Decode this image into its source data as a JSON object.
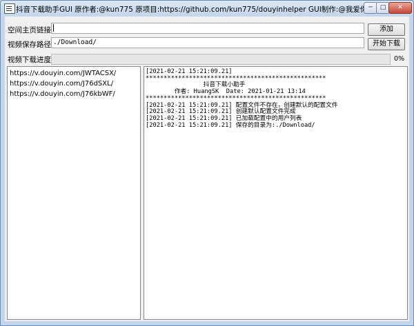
{
  "window": {
    "title": "抖音下载助手GUI 原作者:@kun775 原项目:https://github.com/kun775/douyinhelper GUI制作:@我爱你H大",
    "controls": {
      "minimize": "─",
      "maximize": "□",
      "close": "✕"
    }
  },
  "form": {
    "homepage_label": "空间主页链接",
    "homepage_value": "",
    "add_button": "添加",
    "save_path_label": "视频保存路径",
    "save_path_value": "./Download/",
    "start_button": "开始下载",
    "progress_label": "视频下载进度",
    "progress_value": 0,
    "progress_text": "0%"
  },
  "url_list": [
    "https://v.douyin.com/JWTACSX/",
    "https://v.douyin.com/J76dSXL/",
    "https://v.douyin.com/J76kbWF/"
  ],
  "log_lines": [
    "[2021-02-21 15:21:09.21]",
    "**************************************************",
    "                抖音下载小助手",
    "        作者: HuangSK  Date: 2021-01-21 13:14",
    "**************************************************",
    "[2021-02-21 15:21:09.21] 配置文件不存在，创建默认的配置文件",
    "[2021-02-21 15:21:09.21] 创建默认配置文件完成",
    "[2021-02-21 15:21:09.21] 已加载配置中的用户列表",
    "[2021-02-21 15:21:09.21] 保存的目录为:./Download/"
  ],
  "colors": {
    "progress_fill": "#06b025",
    "window_frame": "#c4d6eb"
  }
}
